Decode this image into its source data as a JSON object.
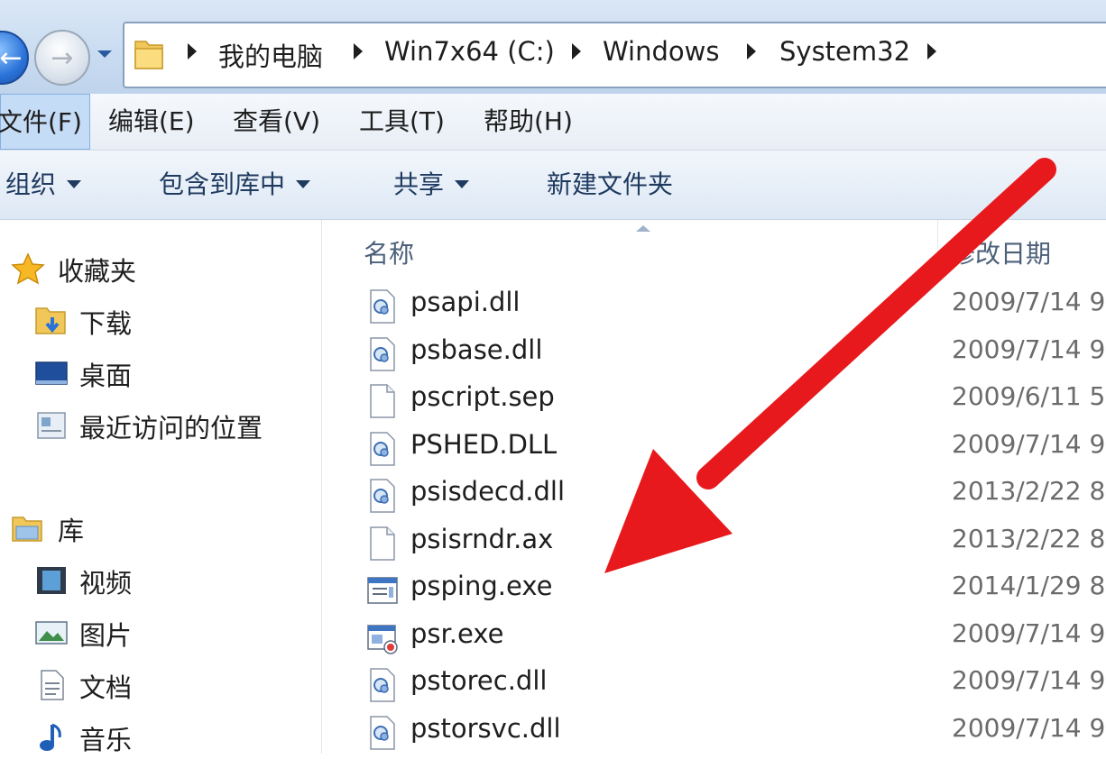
{
  "address_bar": {
    "crumbs": [
      "我的电脑",
      "Win7x64 (C:)",
      "Windows",
      "System32"
    ]
  },
  "menu": {
    "items": [
      "文件(F)",
      "编辑(E)",
      "查看(V)",
      "工具(T)",
      "帮助(H)"
    ]
  },
  "toolbar": {
    "organize": "组织",
    "include_library": "包含到库中",
    "share": "共享",
    "new_folder": "新建文件夹"
  },
  "sidebar": {
    "favorites_label": "收藏夹",
    "favorites": [
      "下载",
      "桌面",
      "最近访问的位置"
    ],
    "libraries_label": "库",
    "libraries": [
      "视频",
      "图片",
      "文档",
      "音乐"
    ]
  },
  "file_list": {
    "columns": {
      "name": "名称",
      "date": "修改日期"
    },
    "files": [
      {
        "name": "psapi.dll",
        "date": "2009/7/14 9",
        "icon": "dll-icon"
      },
      {
        "name": "psbase.dll",
        "date": "2009/7/14 9",
        "icon": "dll-icon"
      },
      {
        "name": "pscript.sep",
        "date": "2009/6/11 5",
        "icon": "file-icon"
      },
      {
        "name": "PSHED.DLL",
        "date": "2009/7/14 9",
        "icon": "dll-icon"
      },
      {
        "name": "psisdecd.dll",
        "date": "2013/2/22 8",
        "icon": "dll-icon"
      },
      {
        "name": "psisrndr.ax",
        "date": "2013/2/22 8",
        "icon": "file-icon"
      },
      {
        "name": "psping.exe",
        "date": "2014/1/29 8",
        "icon": "exe-icon"
      },
      {
        "name": "psr.exe",
        "date": "2009/7/14 9",
        "icon": "psr-exe-icon"
      },
      {
        "name": "pstorec.dll",
        "date": "2009/7/14 9",
        "icon": "dll-icon"
      },
      {
        "name": "pstorsvc.dll",
        "date": "2009/7/14 9",
        "icon": "dll-icon"
      }
    ]
  },
  "annotation": {
    "arrow_color": "#e8191c"
  }
}
